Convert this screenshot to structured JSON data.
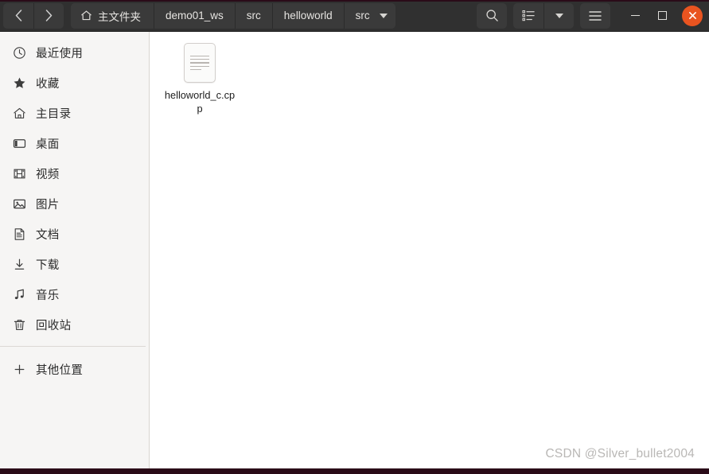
{
  "window": {
    "header_bg": "#303030",
    "accent_close": "#e95420",
    "sidebar_bg": "#f6f5f4",
    "content_bg": "#ffffff"
  },
  "nav": {
    "back_label": "‹",
    "forward_label": "›"
  },
  "breadcrumbs": [
    {
      "label": "主文件夹",
      "icon": "home-icon",
      "has_icon": true
    },
    {
      "label": "demo01_ws",
      "has_icon": false
    },
    {
      "label": "src",
      "has_icon": false
    },
    {
      "label": "helloworld",
      "has_icon": false
    },
    {
      "label": "src",
      "has_icon": false,
      "has_caret": true
    }
  ],
  "toolbar": {
    "search_icon": "search-icon",
    "view_list_icon": "view-list-icon",
    "view_dropdown_icon": "chevron-down-icon",
    "menu_icon": "hamburger-menu-icon"
  },
  "window_controls": {
    "minimize_icon": "minimize-icon",
    "maximize_icon": "maximize-icon",
    "close_icon": "close-icon"
  },
  "sidebar": {
    "items": [
      {
        "label": "最近使用",
        "icon": "clock-icon"
      },
      {
        "label": "收藏",
        "icon": "star-icon"
      },
      {
        "label": "主目录",
        "icon": "home-icon"
      },
      {
        "label": "桌面",
        "icon": "desktop-icon"
      },
      {
        "label": "视频",
        "icon": "film-icon"
      },
      {
        "label": "图片",
        "icon": "image-icon"
      },
      {
        "label": "文档",
        "icon": "document-icon"
      },
      {
        "label": "下载",
        "icon": "download-icon"
      },
      {
        "label": "音乐",
        "icon": "music-note-icon"
      },
      {
        "label": "回收站",
        "icon": "trash-icon"
      }
    ],
    "other_locations": {
      "label": "其他位置",
      "icon": "plus-icon"
    }
  },
  "content": {
    "files": [
      {
        "name": "helloworld_c.cpp",
        "icon": "text-document-icon"
      }
    ]
  },
  "watermark": {
    "text": "CSDN @Silver_bullet2004"
  }
}
